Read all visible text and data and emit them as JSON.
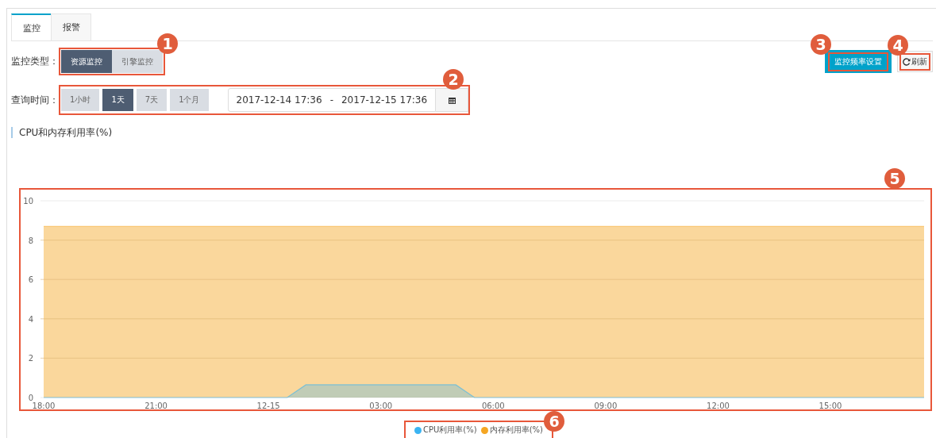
{
  "tabs": [
    {
      "label": "监控",
      "selected": true
    },
    {
      "label": "报警",
      "selected": false
    }
  ],
  "monitor_type": {
    "label": "监控类型：",
    "callout": "1",
    "options": [
      {
        "label": "资源监控",
        "selected": true
      },
      {
        "label": "引擎监控",
        "selected": false
      }
    ]
  },
  "actions": [
    {
      "kind": "primary",
      "label": "监控频率设置",
      "callout": "3"
    },
    {
      "kind": "refresh",
      "label": "刷新",
      "callout": "4"
    }
  ],
  "query_time": {
    "label": "查询时间：",
    "callout": "2",
    "ranges": [
      {
        "label": "1小时",
        "selected": false
      },
      {
        "label": "1天",
        "selected": true
      },
      {
        "label": "7天",
        "selected": false
      },
      {
        "label": "1个月",
        "selected": false
      }
    ],
    "start": "2017-12-14 17:36",
    "separator": "-",
    "end": "2017-12-15 17:36"
  },
  "section_title": "CPU和内存利用率(%)",
  "chart": {
    "callout": "5",
    "legend_callout": "6",
    "chart_data": {
      "type": "area",
      "categories": [
        "18:00",
        null,
        null,
        null,
        null,
        null,
        "21:00",
        null,
        null,
        null,
        null,
        null,
        "12-15",
        null,
        null,
        null,
        null,
        null,
        "03:00",
        null,
        null,
        null,
        null,
        null,
        "06:00",
        null,
        null,
        null,
        null,
        null,
        "09:00",
        null,
        null,
        null,
        null,
        null,
        "12:00",
        null,
        null,
        null,
        null,
        null,
        "15:00",
        null,
        null,
        null,
        null,
        null
      ],
      "series": [
        {
          "name": "CPU利用率(%)",
          "color": "#3bb4f2",
          "values": [
            0,
            0,
            0,
            0,
            0,
            0,
            0,
            0,
            0,
            0,
            0,
            0,
            0,
            0,
            0.65,
            0.65,
            0.65,
            0.65,
            0.65,
            0.65,
            0.65,
            0.65,
            0.65,
            0,
            0,
            0,
            0,
            0,
            0,
            0,
            0,
            0,
            0,
            0,
            0,
            0,
            0,
            0,
            0,
            0,
            0,
            0,
            0,
            0,
            0,
            0,
            0,
            0
          ]
        },
        {
          "name": "内存利用率(%)",
          "color": "#f5a623",
          "values": [
            8.7,
            8.7,
            8.7,
            8.7,
            8.7,
            8.7,
            8.7,
            8.7,
            8.7,
            8.7,
            8.7,
            8.7,
            8.7,
            8.7,
            8.7,
            8.7,
            8.7,
            8.7,
            8.7,
            8.7,
            8.7,
            8.7,
            8.7,
            8.7,
            8.7,
            8.7,
            8.7,
            8.7,
            8.7,
            8.7,
            8.7,
            8.7,
            8.7,
            8.7,
            8.7,
            8.7,
            8.7,
            8.7,
            8.7,
            8.7,
            8.7,
            8.7,
            8.7,
            8.7,
            8.7,
            8.7,
            8.7,
            8.7
          ]
        }
      ],
      "ylim": [
        0,
        10
      ],
      "yticks": [
        0,
        2,
        4,
        6,
        8,
        10
      ],
      "grid": true
    }
  }
}
